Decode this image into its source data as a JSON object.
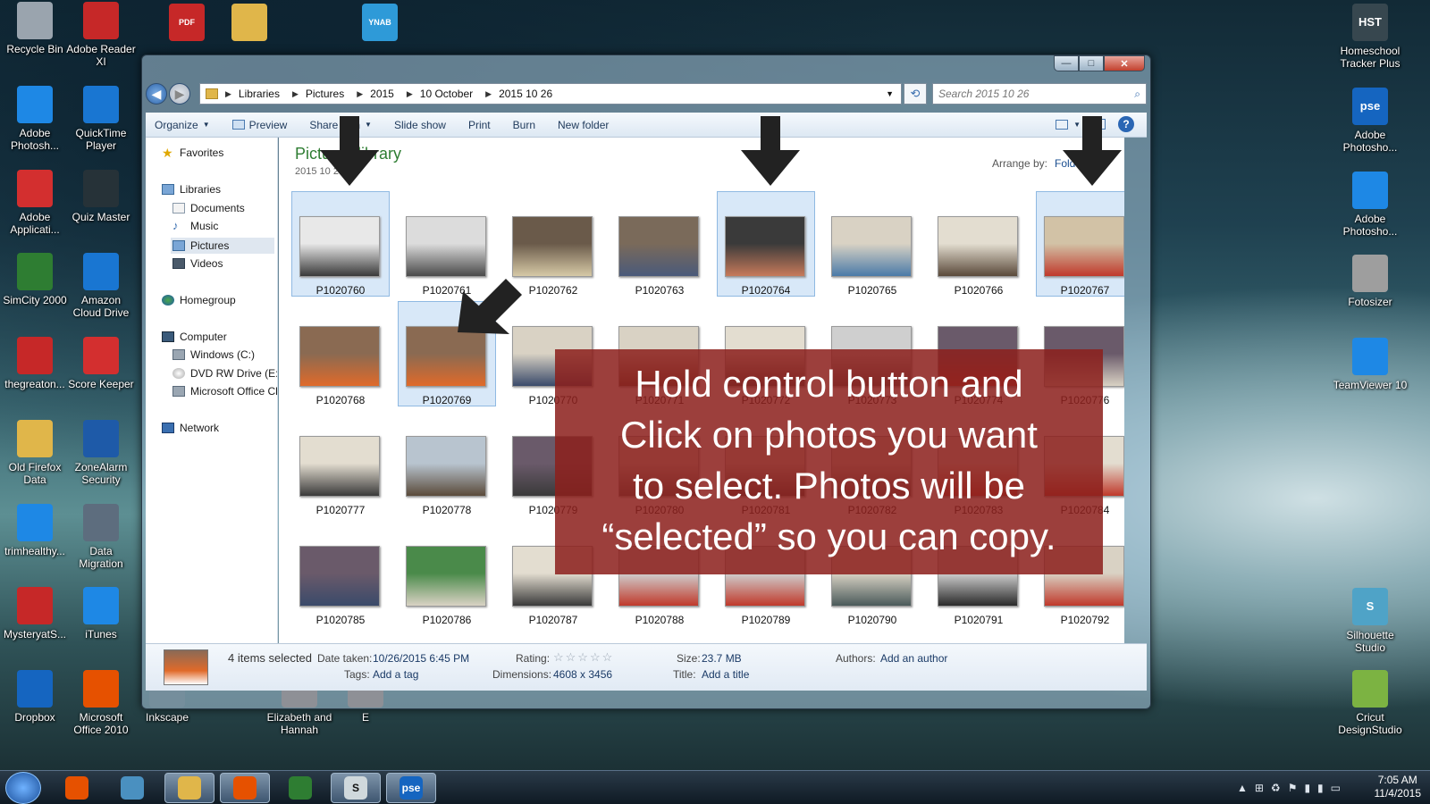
{
  "desktop": {
    "left_icons": [
      {
        "label": "Recycle Bin",
        "color": "#9aa4ae"
      },
      {
        "label": "Adobe Reader XI",
        "color": "#c62828"
      },
      {
        "label": "Adobe Photosh...",
        "color": "#1e88e5"
      },
      {
        "label": "QuickTime Player",
        "color": "#1976d2"
      },
      {
        "label": "Adobe Applicati...",
        "color": "#d32f2f"
      },
      {
        "label": "Quiz Master",
        "color": "#263238"
      },
      {
        "label": "SimCity 2000",
        "color": "#2e7d32"
      },
      {
        "label": "Amazon Cloud Drive",
        "color": "#1976d2"
      },
      {
        "label": "thegreaton...",
        "color": "#c62828"
      },
      {
        "label": "Score Keeper",
        "color": "#d32f2f"
      },
      {
        "label": "Old Firefox Data",
        "color": "#e0b64a"
      },
      {
        "label": "ZoneAlarm Security",
        "color": "#1e5aa8"
      },
      {
        "label": "trimhealthy...",
        "color": "#1e88e5"
      },
      {
        "label": "Data Migration",
        "color": "#5d6d7e"
      },
      {
        "label": "MysteryatS...",
        "color": "#c62828"
      },
      {
        "label": "iTunes",
        "color": "#1e88e5"
      },
      {
        "label": "Dropbox",
        "color": "#1565c0"
      },
      {
        "label": "Microsoft Office 2010",
        "color": "#e65100"
      },
      {
        "label": "Inkscape",
        "color": "#37474f"
      },
      {
        "label": "Elizabeth and Hannah",
        "color": "#6d4c41"
      },
      {
        "label": "E",
        "color": "#6d4c41"
      }
    ],
    "right_icons": [
      {
        "label": "Homeschool Tracker Plus",
        "badge": "HST",
        "color": "#37474f"
      },
      {
        "label": "Adobe Photosho...",
        "badge": "pse",
        "color": "#1565c0"
      },
      {
        "label": "Adobe Photosho...",
        "badge": "",
        "color": "#1e88e5"
      },
      {
        "label": "Fotosizer",
        "badge": "",
        "color": "#9e9e9e"
      },
      {
        "label": "TeamViewer 10",
        "badge": "",
        "color": "#1e88e5"
      },
      {
        "label": "Silhouette Studio",
        "badge": "S",
        "color": "#4fa3c7"
      },
      {
        "label": "Cricut DesignStudio",
        "badge": "",
        "color": "#7cb342"
      }
    ],
    "top_partial_icons": [
      "PDF",
      "",
      "YNAB"
    ]
  },
  "window": {
    "controls": {
      "minimize": "—",
      "maximize": "□",
      "close": "✕"
    },
    "breadcrumbs": [
      "Libraries",
      "Pictures",
      "2015",
      "10 October",
      "2015 10 26"
    ],
    "search_placeholder": "Search 2015 10 26",
    "toolbar": {
      "organize": "Organize",
      "preview": "Preview",
      "share_with": "Share with",
      "slide_show": "Slide show",
      "print": "Print",
      "burn": "Burn",
      "new_folder": "New folder"
    },
    "nav": {
      "favorites": "Favorites",
      "libraries": "Libraries",
      "documents": "Documents",
      "music": "Music",
      "pictures": "Pictures",
      "videos": "Videos",
      "homegroup": "Homegroup",
      "computer": "Computer",
      "windows_c": "Windows (C:)",
      "dvd": "DVD RW Drive (E:) I",
      "ms_office": "Microsoft Office Cl",
      "network": "Network"
    },
    "library": {
      "title": "Pictures library",
      "subtitle": "2015 10 26",
      "arrange_label": "Arrange by:",
      "arrange_value": "Folder"
    },
    "photos": [
      {
        "name": "P1020760",
        "selected": true,
        "c1": "#e8e8e8",
        "c2": "#3a3a3a"
      },
      {
        "name": "P1020761",
        "selected": false,
        "c1": "#dcdcdc",
        "c2": "#4a4a4a"
      },
      {
        "name": "P1020762",
        "selected": false,
        "c1": "#6a5a4a",
        "c2": "#d6c9a6"
      },
      {
        "name": "P1020763",
        "selected": false,
        "c1": "#7a6a5a",
        "c2": "#4a5a7a"
      },
      {
        "name": "P1020764",
        "selected": true,
        "c1": "#3a3a3a",
        "c2": "#c77a5a"
      },
      {
        "name": "P1020765",
        "selected": false,
        "c1": "#d9d2c4",
        "c2": "#4a7aa8"
      },
      {
        "name": "P1020766",
        "selected": false,
        "c1": "#e3ddd0",
        "c2": "#5a4a3a"
      },
      {
        "name": "P1020767",
        "selected": true,
        "c1": "#d2c2a6",
        "c2": "#c0392b"
      },
      {
        "name": "P1020768",
        "selected": false,
        "c1": "#8a6a52",
        "c2": "#e06a2a"
      },
      {
        "name": "P1020769",
        "selected": true,
        "c1": "#8a6a52",
        "c2": "#e06a2a"
      },
      {
        "name": "P1020770",
        "selected": false,
        "c1": "#d9d2c4",
        "c2": "#3a4a6a"
      },
      {
        "name": "P1020771",
        "selected": false,
        "c1": "#d9d2c4",
        "c2": "#6a4a3a"
      },
      {
        "name": "P1020772",
        "selected": false,
        "c1": "#e3ddd0",
        "c2": "#4a4a4a"
      },
      {
        "name": "P1020773",
        "selected": false,
        "c1": "#cfcfcf",
        "c2": "#5a5a5a"
      },
      {
        "name": "P1020774",
        "selected": false,
        "c1": "#6a5a6a",
        "c2": "#c0392b"
      },
      {
        "name": "P1020776",
        "selected": false,
        "c1": "#6a5a6a",
        "c2": "#d9d2c4"
      },
      {
        "name": "P1020777",
        "selected": false,
        "c1": "#e3ddd0",
        "c2": "#3a3a3a"
      },
      {
        "name": "P1020778",
        "selected": false,
        "c1": "#b8c4cf",
        "c2": "#5a4a3a"
      },
      {
        "name": "P1020779",
        "selected": false,
        "c1": "#6a5a6a",
        "c2": "#3a3a3a"
      },
      {
        "name": "P1020780",
        "selected": false,
        "c1": "#d9d2c4",
        "c2": "#5a5a5a"
      },
      {
        "name": "P1020781",
        "selected": false,
        "c1": "#d9d2c4",
        "c2": "#4a4a4a"
      },
      {
        "name": "P1020782",
        "selected": false,
        "c1": "#d9d2c4",
        "c2": "#5a5a5a"
      },
      {
        "name": "P1020783",
        "selected": false,
        "c1": "#e3ddd0",
        "c2": "#c0392b"
      },
      {
        "name": "P1020784",
        "selected": false,
        "c1": "#e3ddd0",
        "c2": "#c0392b"
      },
      {
        "name": "P1020785",
        "selected": false,
        "c1": "#6a5a6a",
        "c2": "#3a4a6a"
      },
      {
        "name": "P1020786",
        "selected": false,
        "c1": "#4a8a4a",
        "c2": "#d9d2c4"
      },
      {
        "name": "P1020787",
        "selected": false,
        "c1": "#e3ddd0",
        "c2": "#3a3a3a"
      },
      {
        "name": "P1020788",
        "selected": false,
        "c1": "#cfcfcf",
        "c2": "#c0392b"
      },
      {
        "name": "P1020789",
        "selected": false,
        "c1": "#cfcfcf",
        "c2": "#c0392b"
      },
      {
        "name": "P1020790",
        "selected": false,
        "c1": "#d9d2c4",
        "c2": "#4a5a5a"
      },
      {
        "name": "P1020791",
        "selected": false,
        "c1": "#cfcfcf",
        "c2": "#2a2a2a"
      },
      {
        "name": "P1020792",
        "selected": false,
        "c1": "#d9d2c4",
        "c2": "#c0392b"
      }
    ],
    "details": {
      "count": "4 items selected",
      "date_label": "Date taken:",
      "date_value": "10/26/2015 6:45 PM",
      "tags_label": "Tags:",
      "tags_value": "Add a tag",
      "rating_label": "Rating:",
      "rating_stars": "☆☆☆☆☆",
      "dimensions_label": "Dimensions:",
      "dimensions_value": "4608 x 3456",
      "size_label": "Size:",
      "size_value": "23.7 MB",
      "title_label": "Title:",
      "title_value": "Add a title",
      "authors_label": "Authors:",
      "authors_value": "Add an author"
    }
  },
  "overlay": {
    "line1": "Hold control button and",
    "line2": "Click on photos you want",
    "line3": "to select.  Photos will be",
    "line4": "“selected” so you can copy."
  },
  "taskbar": {
    "apps": [
      {
        "name": "media-player",
        "color": "#e65100",
        "label": ""
      },
      {
        "name": "people",
        "color": "#4a90c0",
        "label": ""
      },
      {
        "name": "explorer",
        "color": "#e0b64a",
        "label": ""
      },
      {
        "name": "firefox",
        "color": "#e65100",
        "label": ""
      },
      {
        "name": "chrome",
        "color": "#2e7d32",
        "label": ""
      },
      {
        "name": "silhouette",
        "color": "#cfd8dc",
        "label": "S"
      },
      {
        "name": "photoshop-elements",
        "color": "#1565c0",
        "label": "pse"
      }
    ],
    "time": "7:05 AM",
    "date": "11/4/2015"
  }
}
